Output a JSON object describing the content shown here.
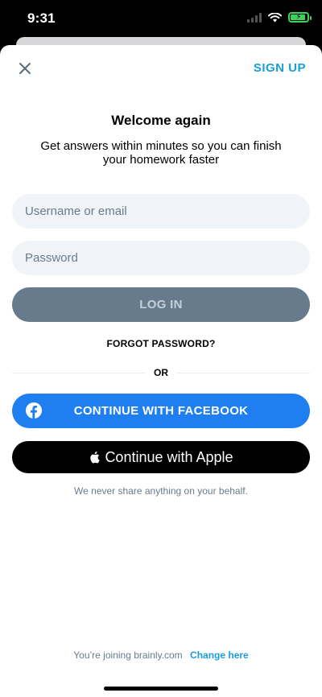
{
  "status_bar": {
    "time": "9:31",
    "icons": [
      "signal-icon",
      "wifi-icon",
      "battery-charging-icon"
    ]
  },
  "header": {
    "close_icon": "close-icon",
    "signup_label": "SIGN UP"
  },
  "welcome": {
    "title": "Welcome again",
    "subtitle": "Get answers within minutes so you can finish your homework faster"
  },
  "form": {
    "username_placeholder": "Username or email",
    "username_value": "",
    "password_placeholder": "Password",
    "password_value": "",
    "login_label": "LOG IN",
    "forgot_label": "FORGOT PASSWORD?"
  },
  "divider_text": "OR",
  "social": {
    "facebook_label": "CONTINUE WITH FACEBOOK",
    "facebook_icon": "facebook-icon",
    "apple_label": "Continue with Apple",
    "apple_icon": "apple-icon"
  },
  "privacy_text": "We never share anything on your behalf.",
  "footer": {
    "joining_text": "You’re joining brainly.com",
    "change_label": "Change here"
  },
  "colors": {
    "accent": "#1a9edb",
    "facebook": "#1f7ef0",
    "login_disabled": "#687b8c",
    "field_bg": "#f0f4f8",
    "battery": "#3bd15a"
  }
}
